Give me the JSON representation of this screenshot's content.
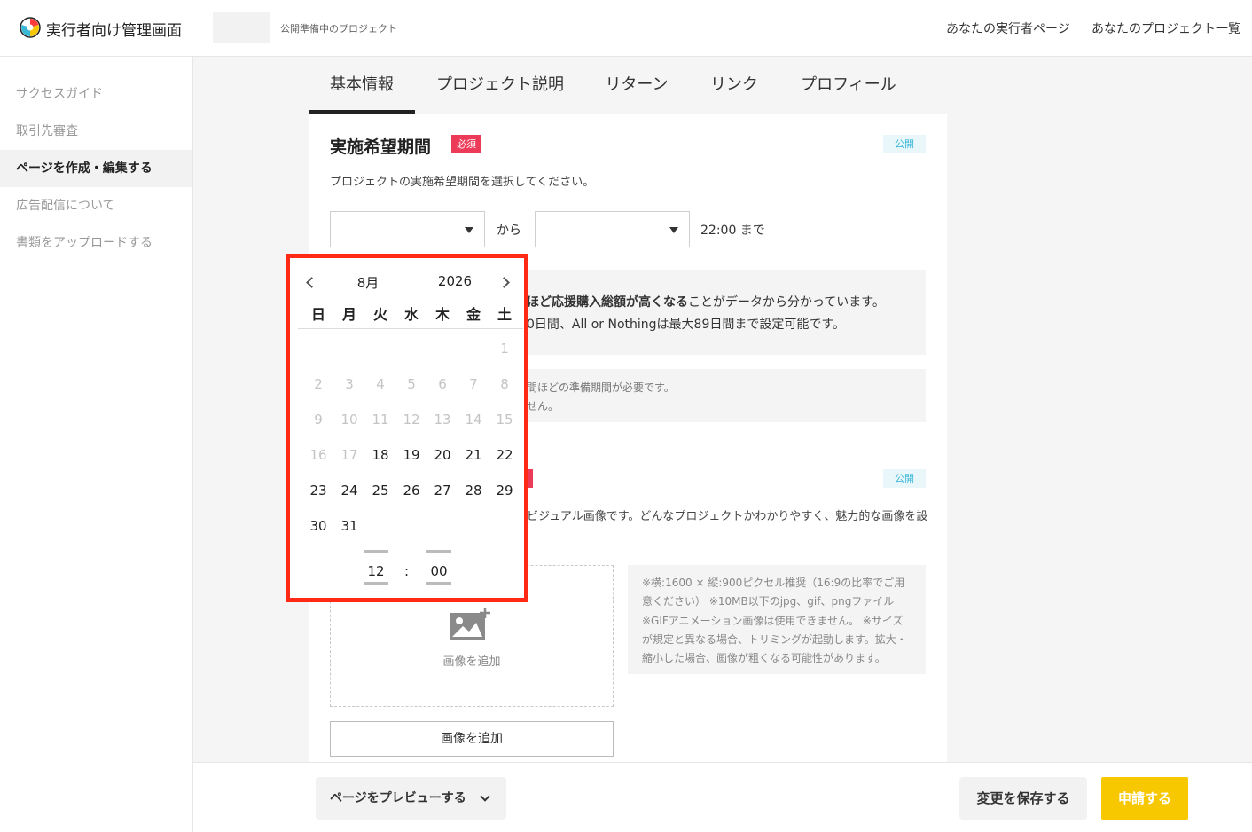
{
  "header": {
    "app_title": "実行者向け管理画面",
    "project_status": "公開準備中のプロジェクト",
    "links": [
      "あなたの実行者ページ",
      "あなたのプロジェクト一覧"
    ]
  },
  "sidebar": {
    "items": [
      {
        "label": "サクセスガイド"
      },
      {
        "label": "取引先審査"
      },
      {
        "label": "ページを作成・編集する",
        "active": true
      },
      {
        "label": "広告配信について"
      },
      {
        "label": "書類をアップロードする"
      }
    ]
  },
  "tabs": [
    {
      "label": "基本情報",
      "active": true
    },
    {
      "label": "プロジェクト説明"
    },
    {
      "label": "リターン"
    },
    {
      "label": "リンク"
    },
    {
      "label": "プロフィール"
    }
  ],
  "period_section": {
    "title": "実施希望期間",
    "required_badge": "必須",
    "public_badge": "公開",
    "description": "プロジェクトの実施希望期間を選択してください。",
    "from_label": "から",
    "until_label": "22:00 まで",
    "info_line1_bold": "ほど応援購入総額が高くなる",
    "info_line1_rest": "ことがデータから分かっています。",
    "info_line2": "0日間、All or Nothingは最大89日間まで設定可能です。",
    "note_line1": "間ほどの準備期間が必要です。",
    "note_line2": "せん。"
  },
  "image_section": {
    "public_badge": "公開",
    "description": "ビジュアル画像です。どんなプロジェクトかわかりやすく、魅力的な画像を設",
    "drop_label": "画像を追加",
    "notes": [
      "※横:1600 × 縦:900ピクセル推奨（16:9の比率でご用",
      "意ください） ※10MB以下のjpg、gif、pngファイル",
      "※GIFアニメーション画像は使用できません。 ※サイズ",
      "が規定と異なる場合、トリミングが起動します。拡大・",
      "縮小した場合、画像が粗くなる可能性があります。"
    ],
    "add_button": "画像を追加"
  },
  "footer": {
    "preview_button": "ページをプレビューする",
    "save_button": "変更を保存する",
    "apply_button": "申請する"
  },
  "calendar": {
    "month": "8月",
    "year": "2026",
    "weekdays": [
      "日",
      "月",
      "火",
      "水",
      "木",
      "金",
      "土"
    ],
    "days": [
      "1",
      "2",
      "3",
      "4",
      "5",
      "6",
      "7",
      "8",
      "9",
      "10",
      "11",
      "12",
      "13",
      "14",
      "15",
      "16",
      "17",
      "18",
      "19",
      "20",
      "21",
      "22",
      "23",
      "24",
      "25",
      "26",
      "27",
      "28",
      "29",
      "30",
      "31"
    ],
    "first_selectable_day": 18,
    "hour": "12",
    "time_colon": ":",
    "minute": "00"
  }
}
